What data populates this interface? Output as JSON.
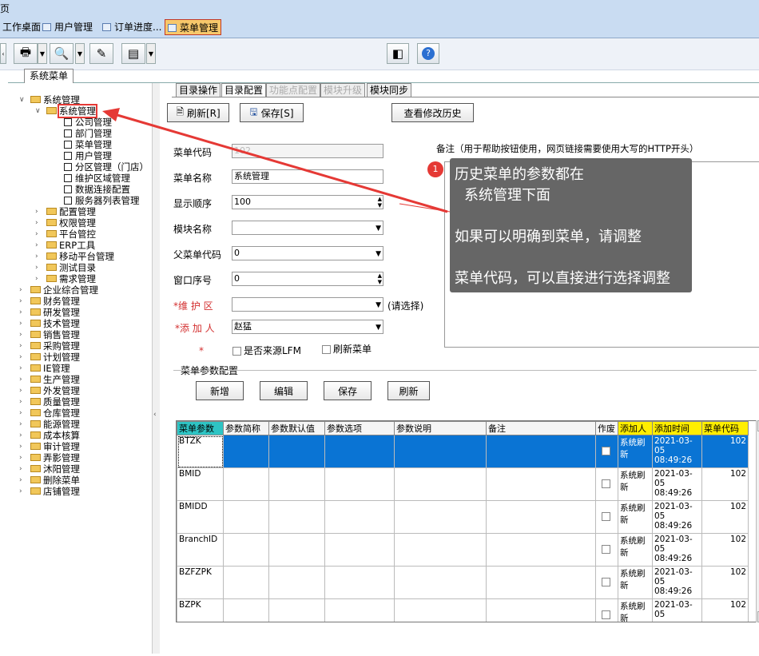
{
  "title_fragment": "页",
  "tabs": [
    {
      "label": "工作桌面",
      "active": false
    },
    {
      "label": "用户管理",
      "active": false
    },
    {
      "label": "订单进度...",
      "active": false
    },
    {
      "label": "菜单管理",
      "active": true
    }
  ],
  "section_tab": "系统菜单",
  "tree": {
    "items": [
      {
        "label": "系统管理",
        "level": 0,
        "expanded": true,
        "type": "folder"
      },
      {
        "label": "系统管理",
        "level": 1,
        "expanded": true,
        "type": "folder",
        "selected": true
      },
      {
        "label": "公司管理",
        "level": 2,
        "type": "leaf"
      },
      {
        "label": "部门管理",
        "level": 2,
        "type": "leaf"
      },
      {
        "label": "菜单管理",
        "level": 2,
        "type": "leaf"
      },
      {
        "label": "用户管理",
        "level": 2,
        "type": "leaf"
      },
      {
        "label": "分区管理（门店）",
        "level": 2,
        "type": "leaf"
      },
      {
        "label": "维护区域管理",
        "level": 2,
        "type": "leaf"
      },
      {
        "label": "数据连接配置",
        "level": 2,
        "type": "leaf"
      },
      {
        "label": "服务器列表管理",
        "level": 2,
        "type": "leaf"
      },
      {
        "label": "配置管理",
        "level": 1,
        "type": "folder"
      },
      {
        "label": "权限管理",
        "level": 1,
        "type": "folder"
      },
      {
        "label": "平台管控",
        "level": 1,
        "type": "folder"
      },
      {
        "label": "ERP工具",
        "level": 1,
        "type": "folder"
      },
      {
        "label": "移动平台管理",
        "level": 1,
        "type": "folder"
      },
      {
        "label": "测试目录",
        "level": 1,
        "type": "folder"
      },
      {
        "label": "需求管理",
        "level": 1,
        "type": "folder"
      },
      {
        "label": "企业综合管理",
        "level": 0,
        "type": "folder"
      },
      {
        "label": "财务管理",
        "level": 0,
        "type": "folder"
      },
      {
        "label": "研发管理",
        "level": 0,
        "type": "folder"
      },
      {
        "label": "技术管理",
        "level": 0,
        "type": "folder"
      },
      {
        "label": "销售管理",
        "level": 0,
        "type": "folder"
      },
      {
        "label": "采购管理",
        "level": 0,
        "type": "folder"
      },
      {
        "label": "计划管理",
        "level": 0,
        "type": "folder"
      },
      {
        "label": "IE管理",
        "level": 0,
        "type": "folder"
      },
      {
        "label": "生产管理",
        "level": 0,
        "type": "folder"
      },
      {
        "label": "外发管理",
        "level": 0,
        "type": "folder"
      },
      {
        "label": "质量管理",
        "level": 0,
        "type": "folder"
      },
      {
        "label": "仓库管理",
        "level": 0,
        "type": "folder"
      },
      {
        "label": "能源管理",
        "level": 0,
        "type": "folder"
      },
      {
        "label": "成本核算",
        "level": 0,
        "type": "folder"
      },
      {
        "label": "审计管理",
        "level": 0,
        "type": "folder"
      },
      {
        "label": "弄影管理",
        "level": 0,
        "type": "folder"
      },
      {
        "label": "沐阳管理",
        "level": 0,
        "type": "folder"
      },
      {
        "label": "删除菜单",
        "level": 0,
        "type": "folder"
      },
      {
        "label": "店铺管理",
        "level": 0,
        "type": "folder"
      }
    ]
  },
  "inner_tabs": [
    {
      "label": "目录操作",
      "state": "normal"
    },
    {
      "label": "目录配置",
      "state": "active"
    },
    {
      "label": "功能点配置",
      "state": "disabled"
    },
    {
      "label": "模块升级",
      "state": "disabled"
    },
    {
      "label": "模块同步",
      "state": "normal"
    }
  ],
  "actions": {
    "refresh": "刷新[R]",
    "save": "保存[S]",
    "history": "查看修改历史"
  },
  "form": {
    "menu_code_label": "菜单代码",
    "menu_code": "102",
    "menu_name_label": "菜单名称",
    "menu_name": "系统管理",
    "display_order_label": "显示顺序",
    "display_order": "100",
    "module_name_label": "模块名称",
    "module_name": "",
    "parent_code_label": "父菜单代码",
    "parent_code": "0",
    "window_index_label": "窗口序号",
    "window_index": "0",
    "maint_area_label": "*维 护 区",
    "maint_area": "",
    "maint_area_hint": "(请选择)",
    "added_by_label": "*添 加 人",
    "added_by": "赵猛",
    "star": "*",
    "from_lfm_label": "是否来源LFM",
    "refresh_menu_label": "刷新菜单",
    "note_label": "备注（用于帮助按钮使用，网页链接需要使用大写的HTTP开头）"
  },
  "tooltip": {
    "number": "1",
    "line1": "历史菜单的参数都在",
    "line2": "系统管理下面",
    "line3": "如果可以明确到菜单，请调整",
    "line4": "菜单代码，可以直接进行选择调整"
  },
  "param_section": {
    "title": "菜单参数配置",
    "buttons": {
      "add": "新增",
      "edit": "编辑",
      "save": "保存",
      "refresh": "刷新"
    }
  },
  "grid": {
    "columns": [
      "菜单参数",
      "参数简称",
      "参数默认值",
      "参数选项",
      "参数说明",
      "备注",
      "作废",
      "添加人",
      "添加时间",
      "菜单代码"
    ],
    "rows": [
      {
        "param": "BTZK",
        "abbr": "",
        "default": "",
        "options": "",
        "desc": "",
        "note": "",
        "void": false,
        "added_by": "系统刷新",
        "added_time": "2021-03-05 08:49:26",
        "menu_code": "102",
        "selected": true
      },
      {
        "param": "BMID",
        "abbr": "",
        "default": "",
        "options": "",
        "desc": "",
        "note": "",
        "void": false,
        "added_by": "系统刷新",
        "added_time": "2021-03-05 08:49:26",
        "menu_code": "102"
      },
      {
        "param": "BMIDD",
        "abbr": "",
        "default": "",
        "options": "",
        "desc": "",
        "note": "",
        "void": false,
        "added_by": "系统刷新",
        "added_time": "2021-03-05 08:49:26",
        "menu_code": "102"
      },
      {
        "param": "BranchID",
        "abbr": "",
        "default": "",
        "options": "",
        "desc": "",
        "note": "",
        "void": false,
        "added_by": "系统刷新",
        "added_time": "2021-03-05 08:49:26",
        "menu_code": "102"
      },
      {
        "param": "BZFZPK",
        "abbr": "",
        "default": "",
        "options": "",
        "desc": "",
        "note": "",
        "void": false,
        "added_by": "系统刷新",
        "added_time": "2021-03-05 08:49:26",
        "menu_code": "102"
      },
      {
        "param": "BZPK",
        "abbr": "",
        "default": "",
        "options": "",
        "desc": "",
        "note": "",
        "void": false,
        "added_by": "系统刷新",
        "added_time": "2021-03-05",
        "menu_code": "102"
      }
    ]
  },
  "colors": {
    "accent": "#e53935",
    "selection": "#0a74d4",
    "header_cyan": "#2ec4c4",
    "header_yellow": "#ffee00",
    "active_tab": "#f7c86b"
  }
}
